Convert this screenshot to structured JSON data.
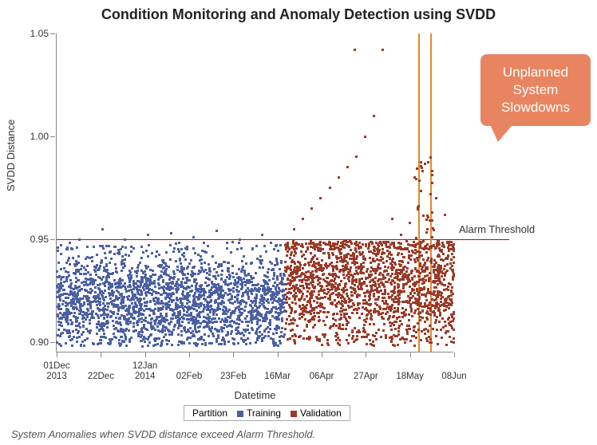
{
  "chart_data": {
    "type": "scatter",
    "title": "Condition Monitoring and Anomaly Detection using SVDD",
    "xlabel": "Datetime",
    "ylabel": "SVDD Distance",
    "ylim": [
      0.895,
      1.05
    ],
    "yticks": [
      0.9,
      0.95,
      1.0,
      1.05
    ],
    "xticks": [
      "01Dec\n2013",
      "22Dec",
      "12Jan\n2014",
      "02Feb",
      "23Feb",
      "16Mar",
      "06Apr",
      "27Apr",
      "18May",
      "08Jun"
    ],
    "alarm_threshold": 0.95,
    "alarm_label": "Alarm Threshold",
    "annotation": "Unplanned\nSystem\nSlowdowns",
    "annotation_x_lines_approx": [
      "04Jun",
      "07Jun"
    ],
    "legend": {
      "title": "Partition",
      "items": [
        {
          "name": "Training",
          "color": "#4b5fa3"
        },
        {
          "name": "Validation",
          "color": "#9a3a28"
        }
      ]
    },
    "series": [
      {
        "name": "Training",
        "color": "#4b5fa3",
        "x_range_days": [
          0,
          115
        ],
        "baseline_mean": 0.92,
        "baseline_sd": 0.012,
        "dense_count_approx": 2300,
        "spikes_above_threshold": [
          0.95,
          0.955,
          0.95,
          0.952,
          0.953,
          0.951,
          0.954,
          0.95,
          0.952
        ]
      },
      {
        "name": "Validation",
        "color": "#9a3a28",
        "x_range_days": [
          115,
          200
        ],
        "baseline_mean": 0.928,
        "baseline_sd": 0.015,
        "dense_count_approx": 1800,
        "spikes_above_threshold": [
          0.955,
          0.96,
          0.965,
          0.97,
          0.975,
          0.98,
          0.985,
          0.99,
          1.0,
          1.01,
          1.042,
          0.96,
          0.952,
          0.958,
          0.966,
          0.955,
          0.97,
          0.962
        ]
      }
    ],
    "notable_points": [
      {
        "series": "Validation",
        "approx_date": "05May",
        "value": 1.042
      },
      {
        "series": "Validation",
        "approx_date": "06Jun",
        "value": 0.99
      }
    ]
  },
  "footnote": "System Anomalies when SVDD distance exceed Alarm Threshold."
}
